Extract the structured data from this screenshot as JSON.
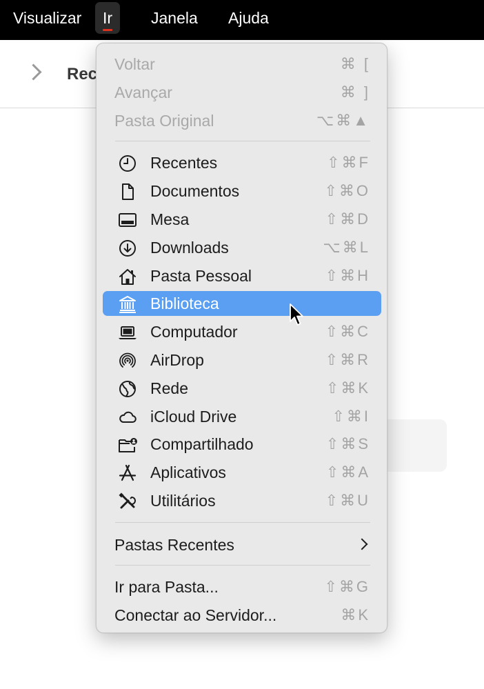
{
  "menubar": {
    "items": [
      {
        "label": "Visualizar"
      },
      {
        "label": "Ir"
      },
      {
        "label": "Janela"
      },
      {
        "label": "Ajuda"
      }
    ],
    "active_index": 1,
    "accent_color": "#e0331f"
  },
  "window": {
    "title": "Rec"
  },
  "go_menu": {
    "highlight_color": "#5a9ff2",
    "items": [
      {
        "label": "Voltar",
        "shortcut": "⌘ [",
        "enabled": false
      },
      {
        "label": "Avançar",
        "shortcut": "⌘ ]",
        "enabled": false
      },
      {
        "label": "Pasta Original",
        "shortcut": "⌥⌘▲",
        "enabled": false
      },
      {
        "label": "Recentes",
        "shortcut": "⇧⌘F",
        "icon": "clock-icon"
      },
      {
        "label": "Documentos",
        "shortcut": "⇧⌘O",
        "icon": "document-icon"
      },
      {
        "label": "Mesa",
        "shortcut": "⇧⌘D",
        "icon": "desktop-icon"
      },
      {
        "label": "Downloads",
        "shortcut": "⌥⌘L",
        "icon": "download-icon"
      },
      {
        "label": "Pasta Pessoal",
        "shortcut": "⇧⌘H",
        "icon": "home-icon"
      },
      {
        "label": "Biblioteca",
        "shortcut": "",
        "icon": "library-icon",
        "highlighted": true
      },
      {
        "label": "Computador",
        "shortcut": "⇧⌘C",
        "icon": "laptop-icon"
      },
      {
        "label": "AirDrop",
        "shortcut": "⇧⌘R",
        "icon": "airdrop-icon"
      },
      {
        "label": "Rede",
        "shortcut": "⇧⌘K",
        "icon": "globe-icon"
      },
      {
        "label": "iCloud Drive",
        "shortcut": "⇧⌘I",
        "icon": "cloud-icon"
      },
      {
        "label": "Compartilhado",
        "shortcut": "⇧⌘S",
        "icon": "shared-folder-icon"
      },
      {
        "label": "Aplicativos",
        "shortcut": "⇧⌘A",
        "icon": "applications-icon"
      },
      {
        "label": "Utilitários",
        "shortcut": "⇧⌘U",
        "icon": "utilities-icon"
      },
      {
        "label": "Pastas Recentes",
        "shortcut": "",
        "submenu": true
      },
      {
        "label": "Ir para Pasta...",
        "shortcut": "⇧⌘G"
      },
      {
        "label": "Conectar ao Servidor...",
        "shortcut": "⌘K"
      }
    ]
  }
}
